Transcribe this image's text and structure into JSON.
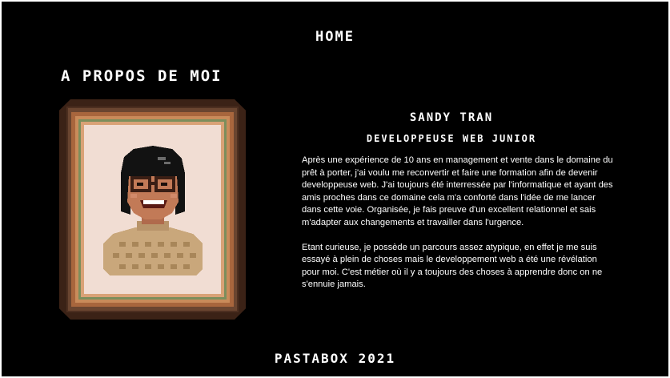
{
  "nav": {
    "home_label": "HOME"
  },
  "about": {
    "section_title": "A PROPOS DE MOI",
    "name": "SANDY TRAN",
    "role": "DEVELOPPEUSE WEB JUNIOR",
    "paragraphs": [
      "Après une expérience de 10 ans en management et vente dans le domaine du prêt à porter, j'ai voulu me reconvertir et faire une formation afin de devenir developpeuse web. J'ai toujours été interressée par l'informatique et ayant des amis proches dans ce domaine cela m'a conforté dans l'idée de me lancer dans cette voie. Organisée, je fais preuve d'un excellent relationnel et sais m'adapter aux changements et travailler dans l'urgence.",
      "Etant curieuse, je possède un parcours assez atypique, en effet je me suis essayé à plein de choses mais le developpement web a été une révélation pour moi. C'est métier où il y a toujours des choses à apprendre donc on ne s'ennuie jamais."
    ]
  },
  "footer": {
    "text": "PASTABOX 2021"
  },
  "colors": {
    "background": "#000000",
    "text": "#ffffff",
    "frame_dark": "#3b2216",
    "frame_mid": "#a8663d",
    "canvas": "#f1ddd3",
    "sweater": "#c9a77b"
  }
}
